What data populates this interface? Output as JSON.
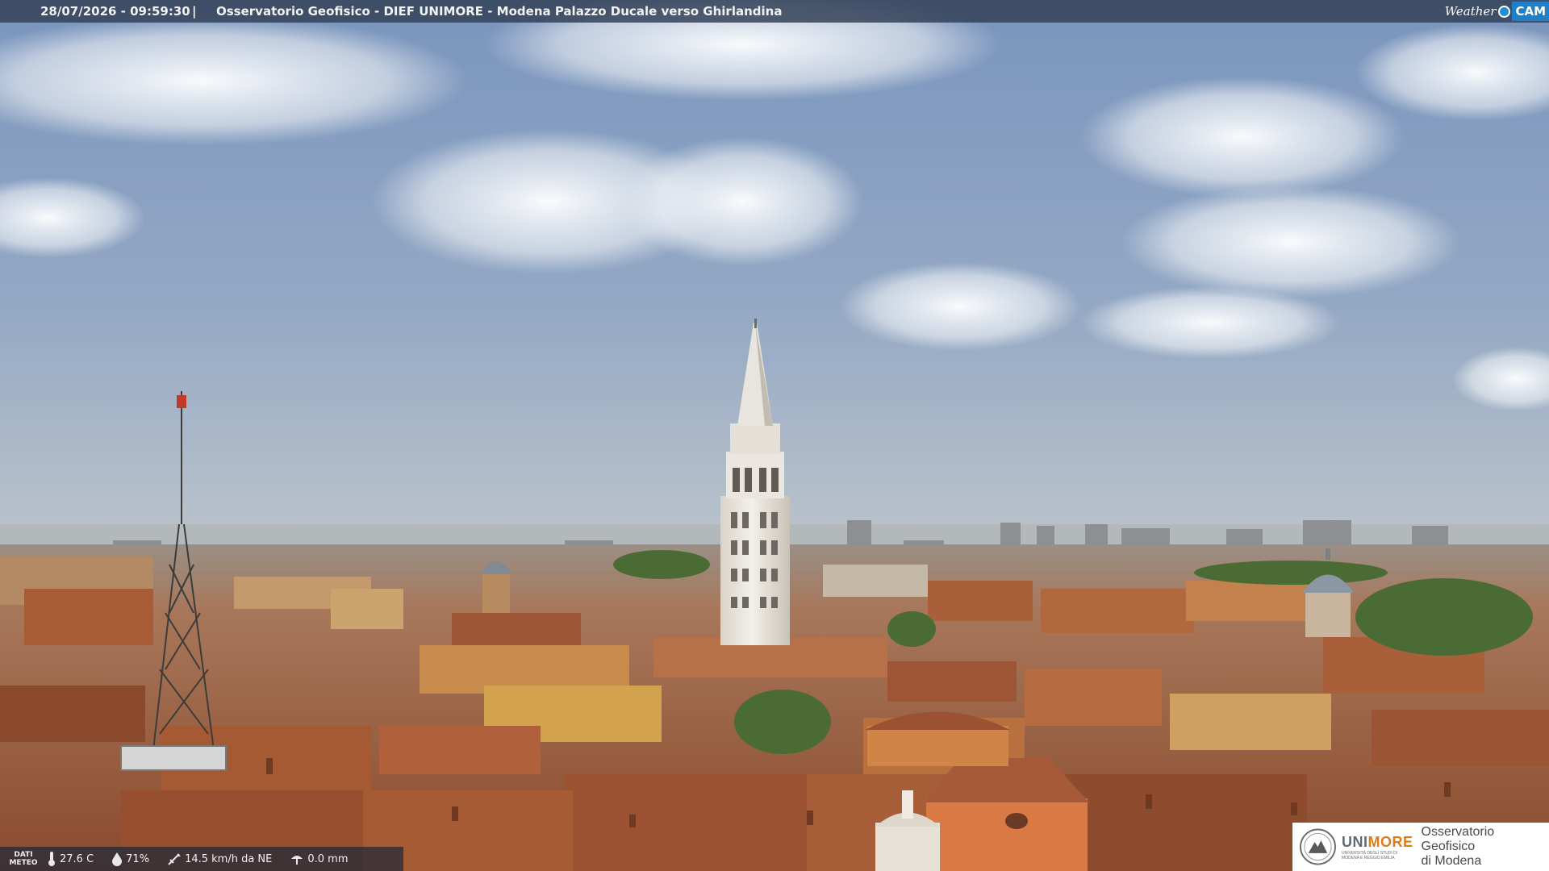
{
  "overlay": {
    "timestamp": "28/07/2026 - 09:59:30",
    "separator": "|",
    "title": "Osservatorio Geofisico - DIEF UNIMORE - Modena Palazzo Ducale verso Ghirlandina"
  },
  "brand": {
    "weather": "Weather",
    "cam": "CAM"
  },
  "meteo": {
    "label_line1": "DATI",
    "label_line2": "METEO",
    "temperature": "27.6 C",
    "humidity": "71%",
    "wind": "14.5 km/h da NE",
    "rain": "0.0 mm",
    "icons": [
      "thermometer-icon",
      "humidity-drop-icon",
      "wind-vane-icon",
      "rain-gauge-icon"
    ]
  },
  "logo": {
    "unimore_prefix": "UNI",
    "unimore_suffix": "MORE",
    "university_line1": "UNIVERSITÀ DEGLI STUDI DI",
    "university_line2": "MODENA E REGGIO EMILIA",
    "observatory_line1": "Osservatorio Geofisico",
    "observatory_line2": "di Modena"
  },
  "colors": {
    "sky_top": "#7f98bd",
    "sky_horizon": "#b9c3cc",
    "roof": "#a9603a",
    "tower": "#e8e4dc",
    "overlay_bar": "#344258",
    "brand_blue": "#1f7fc8",
    "unimore_orange": "#e07b1a"
  }
}
